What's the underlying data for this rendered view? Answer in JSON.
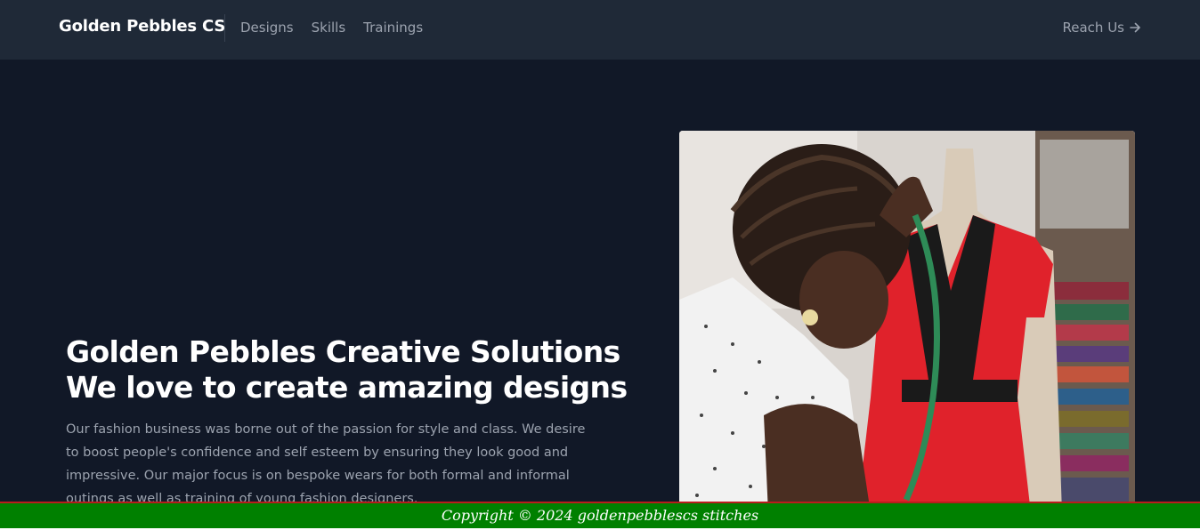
{
  "navbar": {
    "brand": "Golden Pebbles CS",
    "links": [
      "Designs",
      "Skills",
      "Trainings"
    ],
    "cta_label": "Reach Us"
  },
  "hero": {
    "title_line1": "Golden Pebbles Creative Solutions",
    "title_line2": "We love to create amazing designs",
    "description": "Our fashion business was borne out of the passion for style and class. We desire to boost people's confidence and self esteem by ensuring they look good and impressive. Our major focus is on bespoke wears for both formal and informal outings as well as training of young fashion designers."
  },
  "footer": {
    "copyright": "Copyright © 2024 goldenpebblescs stitches"
  },
  "colors": {
    "page_bg": "#111827",
    "navbar_bg": "#1f2937",
    "footer_bg": "#008000",
    "footer_border": "#b91c1c",
    "dress_red": "#e0222b"
  },
  "icons": {
    "reach_arrow": "arrow-right-icon"
  }
}
